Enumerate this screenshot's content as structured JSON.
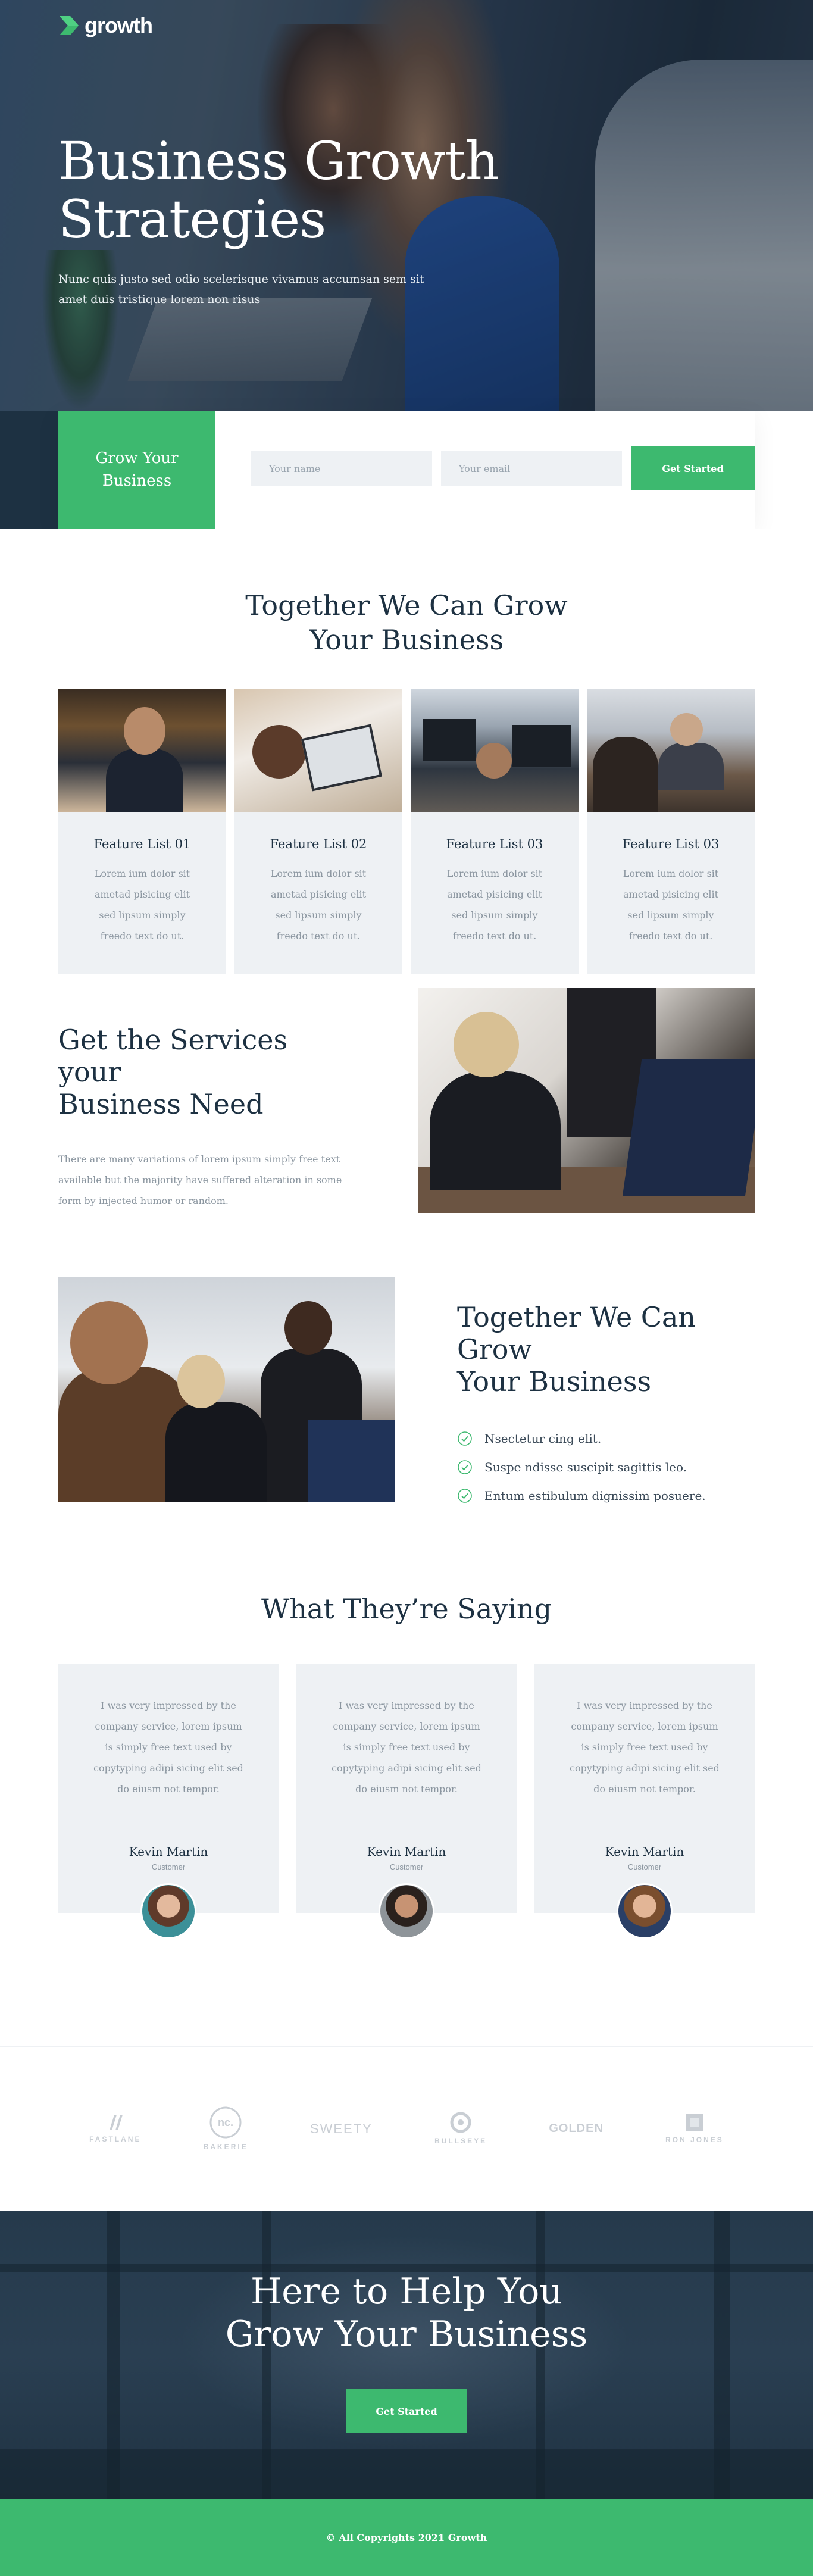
{
  "brand": {
    "name": "growth",
    "accent": "#3db96f",
    "dark": "#1d3142"
  },
  "hero": {
    "title_line1": "Business Growth",
    "title_line2": "Strategies",
    "subtitle": "Nunc quis justo sed odio scelerisque vivamus accumsan sem sit amet duis tristique lorem non risus"
  },
  "cta": {
    "label_line1": "Grow Your",
    "label_line2": "Business",
    "name_placeholder": "Your name",
    "email_placeholder": "Your email",
    "button": "Get Started"
  },
  "features": {
    "title_line1": "Together We Can Grow",
    "title_line2": "Your Business",
    "items": [
      {
        "title": "Feature List 01",
        "text": "Lorem ium dolor sit ametad pisicing elit sed lipsum simply freedo text do ut."
      },
      {
        "title": "Feature List 02",
        "text": "Lorem ium dolor sit ametad pisicing elit sed lipsum simply freedo text do ut."
      },
      {
        "title": "Feature List 03",
        "text": "Lorem ium dolor sit ametad pisicing elit sed lipsum simply freedo text do ut."
      },
      {
        "title": "Feature List 03",
        "text": "Lorem ium dolor sit ametad pisicing elit sed lipsum simply freedo text do ut."
      }
    ]
  },
  "services": {
    "title_line1": "Get the Services your",
    "title_line2": "Business Need",
    "text": "There are many variations of lorem ipsum simply free text available but the majority have suffered alteration in some form by injected humor or random."
  },
  "together": {
    "title_line1": "Together We Can Grow",
    "title_line2": "Your Business",
    "checklist": [
      "Nsectetur cing elit.",
      "Suspe ndisse suscipit sagittis leo.",
      "Entum estibulum dignissim posuere."
    ]
  },
  "testimonials": {
    "title": "What They’re Saying",
    "items": [
      {
        "quote": "I was very impressed by the company service, lorem ipsum is simply free text used by copytyping adipi sicing elit sed do eiusm not tempor.",
        "name": "Kevin Martin",
        "role": "Customer"
      },
      {
        "quote": "I was very impressed by the company service, lorem ipsum is simply free text used by copytyping adipi sicing elit sed do eiusm not tempor.",
        "name": "Kevin Martin",
        "role": "Customer"
      },
      {
        "quote": "I was very impressed by the company service, lorem ipsum is simply free text used by copytyping adipi sicing elit sed do eiusm not tempor.",
        "name": "Kevin Martin",
        "role": "Customer"
      }
    ]
  },
  "brands": [
    "FASTLANE",
    "BAKERIE",
    "SWEETY",
    "BULLSEYE",
    "GOLDEN",
    "RON JONES"
  ],
  "banner": {
    "title_line1": "Here to Help You",
    "title_line2": "Grow Your Business",
    "button": "Get Started"
  },
  "footer": {
    "copyright": "© All Copyrights 2021 Growth"
  }
}
